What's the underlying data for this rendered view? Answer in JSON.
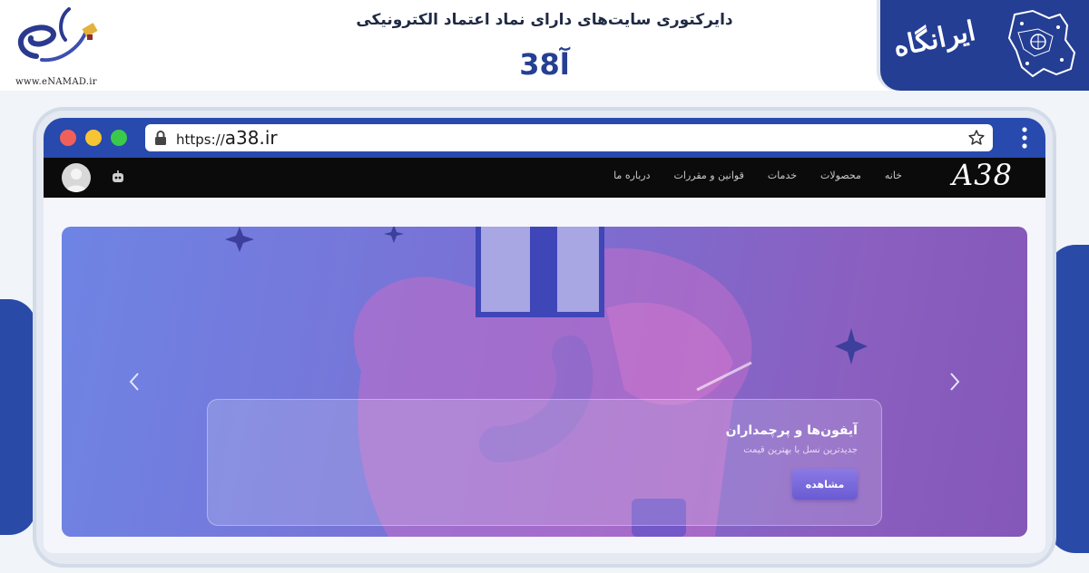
{
  "header": {
    "title": "دایرکتوری سایت‌های دارای نماد اعتماد الکترونیکی",
    "domain": "آ38"
  },
  "enamad": {
    "text": "www.eNAMAD.ir",
    "icon": "enamad-logo-icon"
  },
  "brand": {
    "text": "ایرانگاه",
    "icon": "iran-map-icon",
    "color": "#243e94"
  },
  "browser": {
    "url_protocol": "https://",
    "url_host": "a38.ir",
    "icons": [
      "lock-icon",
      "star-icon",
      "kebab-menu-icon"
    ],
    "bar_color": "#2849ad"
  },
  "site": {
    "logo": "A38",
    "nav": [
      "خانه",
      "محصولات",
      "خدمات",
      "قوانین و مقررات",
      "درباره ما"
    ],
    "icons": [
      "user-avatar-icon",
      "robot-icon"
    ]
  },
  "hero": {
    "title": "آیفون‌ها و پرچمداران",
    "subtitle": "جدیدترین نسل با بهترین قیمت",
    "button": "مشاهده",
    "icons": [
      "chevron-left-icon",
      "chevron-right-icon"
    ]
  }
}
